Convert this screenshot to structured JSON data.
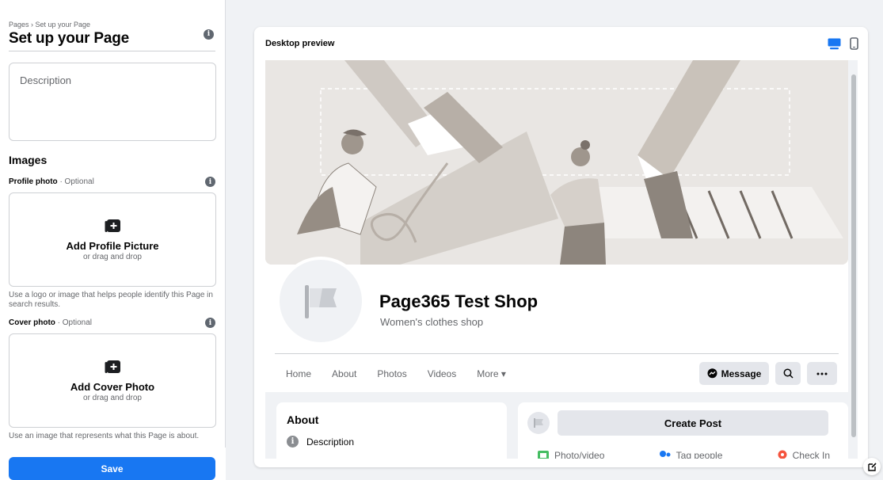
{
  "sidebar": {
    "breadcrumb": "Pages › Set up your Page",
    "title": "Set up your Page",
    "description_placeholder": "Description",
    "images_heading": "Images",
    "profile_photo": {
      "label": "Profile photo",
      "optional": " · Optional",
      "upload_title": "Add Profile Picture",
      "upload_sub": "or drag and drop",
      "hint": "Use a logo or image that helps people identify this Page in search results."
    },
    "cover_photo": {
      "label": "Cover photo",
      "optional": " · Optional",
      "upload_title": "Add Cover Photo",
      "upload_sub": "or drag and drop",
      "hint": "Use an image that represents what this Page is about."
    },
    "save_label": "Save"
  },
  "preview": {
    "title": "Desktop preview",
    "page_name": "Page365 Test Shop",
    "category": "Women's clothes shop",
    "tabs": [
      "Home",
      "About",
      "Photos",
      "Videos",
      "More ▾"
    ],
    "message_label": "Message",
    "about_title": "About",
    "about_description": "Description",
    "create_post_label": "Create Post",
    "post_actions": [
      "Photo/video",
      "Tag people",
      "Check In"
    ]
  },
  "colors": {
    "accent": "#1877f2",
    "cover_bg": "#e9e6e3"
  },
  "icons": [
    "info-icon",
    "add-photo-icon",
    "desktop-icon",
    "mobile-icon",
    "flag-icon",
    "messenger-icon",
    "search-icon",
    "more-icon",
    "edit-icon"
  ]
}
